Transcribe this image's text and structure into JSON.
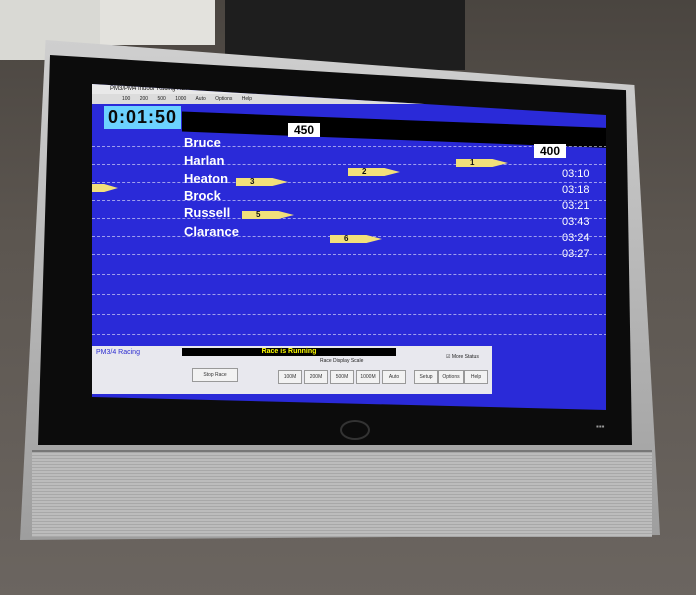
{
  "window": {
    "title": "PM3/PM4 Indoor Racing   Race:Untitled   View: 100",
    "menu": [
      "100",
      "200",
      "500",
      "1000",
      "Auto",
      "Options",
      "Help"
    ]
  },
  "race": {
    "timer": "0:01:50",
    "distance_near": "450",
    "distance_far": "400"
  },
  "rowers": [
    {
      "name": "Bruce",
      "boat": "1",
      "time": "03:10"
    },
    {
      "name": "Harlan",
      "boat": "2",
      "time": "03:18"
    },
    {
      "name": "Heaton",
      "boat": "3",
      "time": "03:21"
    },
    {
      "name": "Brock",
      "boat": "",
      "time": "03:43"
    },
    {
      "name": "Russell",
      "boat": "5",
      "time": "03:24"
    },
    {
      "name": "Clarance",
      "boat": "6",
      "time": "03:27"
    }
  ],
  "panel": {
    "title": "PM3/4 Racing",
    "status": "Race is Running",
    "buttons": [
      "Stop Race"
    ],
    "scale_label": "Race Display Scale",
    "scale_buttons": [
      "100M",
      "200M",
      "500M",
      "1000M",
      "Auto"
    ],
    "right_buttons": [
      "Setup",
      "Options",
      "Help"
    ],
    "checkbox_label": "More Status"
  },
  "colors": {
    "screen_blue": "#2a2ad8",
    "timer_bg": "#6cd2ff",
    "boat_yellow": "#f2e07a"
  }
}
